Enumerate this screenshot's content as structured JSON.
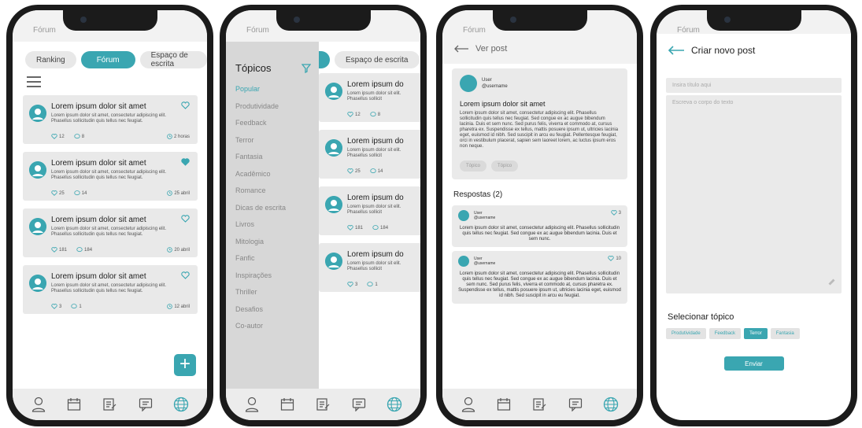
{
  "colors": {
    "accent": "#3aa6b1",
    "card": "#e9e9e9",
    "drawer": "#d7d7d7"
  },
  "app_title": "Fórum",
  "screen1": {
    "tabs": [
      "Ranking",
      "Fórum",
      "Espaço de escrita"
    ],
    "posts": [
      {
        "title": "Lorem ipsum dolor sit amet",
        "body": "Lorem ipsum dolor sit amet, consectetur adipiscing elit. Phasellus sollicitudin quis tellus nec feugiat.",
        "likes": "12",
        "comments": "8",
        "time": "2 horas",
        "liked": false
      },
      {
        "title": "Lorem ipsum dolor sit amet",
        "body": "Lorem ipsum dolor sit amet, consectetur adipiscing elit. Phasellus sollicitudin quis tellus nec feugiat.",
        "likes": "25",
        "comments": "14",
        "time": "25 abril",
        "liked": true
      },
      {
        "title": "Lorem ipsum dolor sit amet",
        "body": "Lorem ipsum dolor sit amet, consectetur adipiscing elit. Phasellus sollicitudin quis tellus nec feugiat.",
        "likes": "181",
        "comments": "184",
        "time": "20 abril",
        "liked": false
      },
      {
        "title": "Lorem ipsum dolor sit amet",
        "body": "Lorem ipsum dolor sit amet, consectetur adipiscing elit. Phasellus sollicitudin quis tellus nec feugiat.",
        "likes": "3",
        "comments": "1",
        "time": "12 abril",
        "liked": false
      }
    ],
    "fab_label": "+"
  },
  "screen2": {
    "drawer_title": "Tópicos",
    "topics": [
      "Popular",
      "Produtividade",
      "Feedback",
      "Terror",
      "Fantasia",
      "Acadêmico",
      "Romance",
      "Dicas de escrita",
      "Livros",
      "Mitologia",
      "Fanfic",
      "Inspirações",
      "Thriller",
      "Desafios",
      "Co-autor"
    ],
    "tab_visible": "Espaço de escrita",
    "posts": [
      {
        "title": "Lorem ipsum do",
        "body": "Lorem ipsum dolor sit elit. Phasellus sollicit",
        "likes": "12",
        "comments": "8"
      },
      {
        "title": "Lorem ipsum do",
        "body": "Lorem ipsum dolor sit elit. Phasellus sollicit",
        "likes": "25",
        "comments": "14"
      },
      {
        "title": "Lorem ipsum do",
        "body": "Lorem ipsum dolor sit elit. Phasellus sollicit",
        "likes": "181",
        "comments": "184"
      },
      {
        "title": "Lorem ipsum do",
        "body": "Lorem ipsum dolor sit elit. Phasellus sollicit",
        "likes": "3",
        "comments": "1"
      }
    ]
  },
  "screen3": {
    "header": "Ver post",
    "user_name": "User",
    "user_handle": "@username",
    "post_title": "Lorem ipsum dolor sit amet",
    "post_body": "Lorem ipsum dolor sit amet, consectetur adipiscing elit. Phasellus sollicitudin quis tellus nec feugiat. Sed congue ex ac augue bibendum lacinia. Duis et sem nunc. Sed purus felis, viverra et commodo at, cursus pharetra ex. Suspendisse ex tellus, mattis posuere ipsum ut, ultricies lacinia eget, euismod id nibh. Sed suscipit in arcu eu feugiat. Pellentesque feugiat, orci in vestibulum placerat, sapien sem laoreet lorem, ac luctus ipsum eros non neque.",
    "chips": [
      "Tópico",
      "Tópico"
    ],
    "responses_header": "Respostas (2)",
    "replies": [
      {
        "user": "User",
        "handle": "@username",
        "likes": "3",
        "body": "Lorem ipsum dolor sit amet, consectetur adipiscing elit. Phasellus sollicitudin quis tellus nec feugiat. Sed congue ex ac augue bibendum lacinia. Duis et sem nunc."
      },
      {
        "user": "User",
        "handle": "@username",
        "likes": "10",
        "body": "Lorem ipsum dolor sit amet, consectetur adipiscing elit. Phasellus sollicitudin quis tellus nec feugiat. Sed congue ex ac augue bibendum lacinia. Duis et sem nunc. Sed purus felis, viverra et commodo at, cursus pharetra ex. Suspendisse ex tellus, mattis posuere ipsum ut, ultricies lacinia eget, euismod id nibh. Sed suscipit in arcu eu feugiat."
      }
    ]
  },
  "screen4": {
    "header": "Criar novo post",
    "title_placeholder": "Insira título aqui",
    "body_placeholder": "Escreva o corpo do texto",
    "select_topic": "Selecionar tópico",
    "topics": [
      "Produtividade",
      "Feedback",
      "Terror",
      "Fantasia"
    ],
    "selected_topic": "Terror",
    "submit": "Enviar"
  },
  "nav_icons": [
    "profile-icon",
    "calendar-icon",
    "notes-icon",
    "chat-icon",
    "globe-icon"
  ]
}
